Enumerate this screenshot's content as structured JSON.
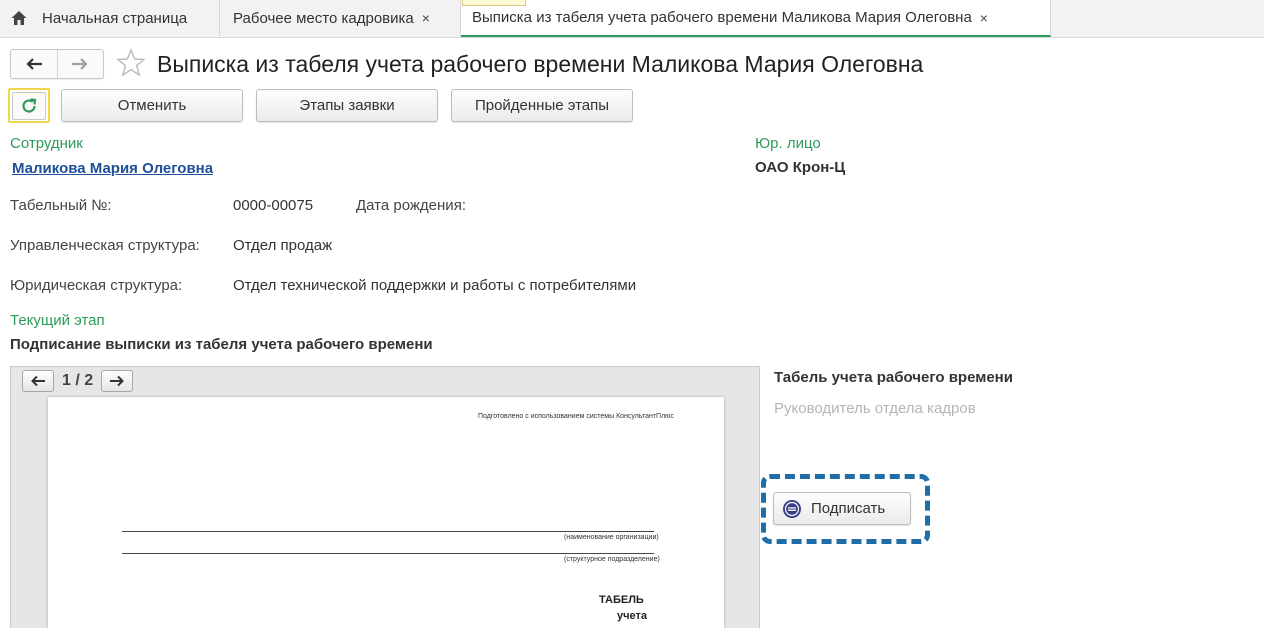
{
  "tabs": [
    {
      "label": "Начальная страница",
      "icon": "home-icon"
    },
    {
      "label": "Рабочее место кадровика",
      "close": "×"
    },
    {
      "label": "Выписка из табеля учета рабочего времени Маликова Мария Олеговна",
      "close": "×"
    }
  ],
  "header": {
    "back_icon": "arrow-left-icon",
    "forward_icon": "arrow-right-icon",
    "favorite_icon": "star-icon",
    "title": "Выписка из табеля учета рабочего времени Маликова Мария Олеговна"
  },
  "toolbar": {
    "refresh_icon": "refresh-icon",
    "cancel_label": "Отменить",
    "stages_label": "Этапы заявки",
    "passed_stages_label": "Пройденные этапы"
  },
  "employee": {
    "section_label": "Сотрудник",
    "name": "Маликова Мария Олеговна",
    "tab_number_label": "Табельный №:",
    "tab_number": "0000-00075",
    "birth_date_label": "Дата рождения:",
    "management_structure_label": "Управленческая структура:",
    "management_structure": "Отдел продаж",
    "legal_structure_label": "Юридическая структура:",
    "legal_structure": "Отдел технической поддержки и работы с потребителями"
  },
  "legal_entity": {
    "label": "Юр. лицо",
    "value": "ОАО Крон-Ц"
  },
  "stage": {
    "label": "Текущий этап",
    "value": "Подписание выписки из табеля учета рабочего времени"
  },
  "preview": {
    "page_indicator": "1 / 2",
    "prev": "←",
    "next": "→",
    "prepared_note": "Подготовлено с использованием системы КонсультантПлюс",
    "org_caption": "(наименование организации)",
    "dept_caption": "(структурное подразделение)",
    "doc_title_1": "ТАБЕЛЬ",
    "doc_title_2": "учета"
  },
  "signing": {
    "doc_title": "Табель учета рабочего времени",
    "role": "Руководитель отдела кадров",
    "sign_label": "Подписать",
    "sign_icon": "signature-seal-icon",
    "highlight_color": "#1f6ea8"
  },
  "colors": {
    "accent_green": "#2e9b5a",
    "link_blue": "#1e4f99"
  }
}
